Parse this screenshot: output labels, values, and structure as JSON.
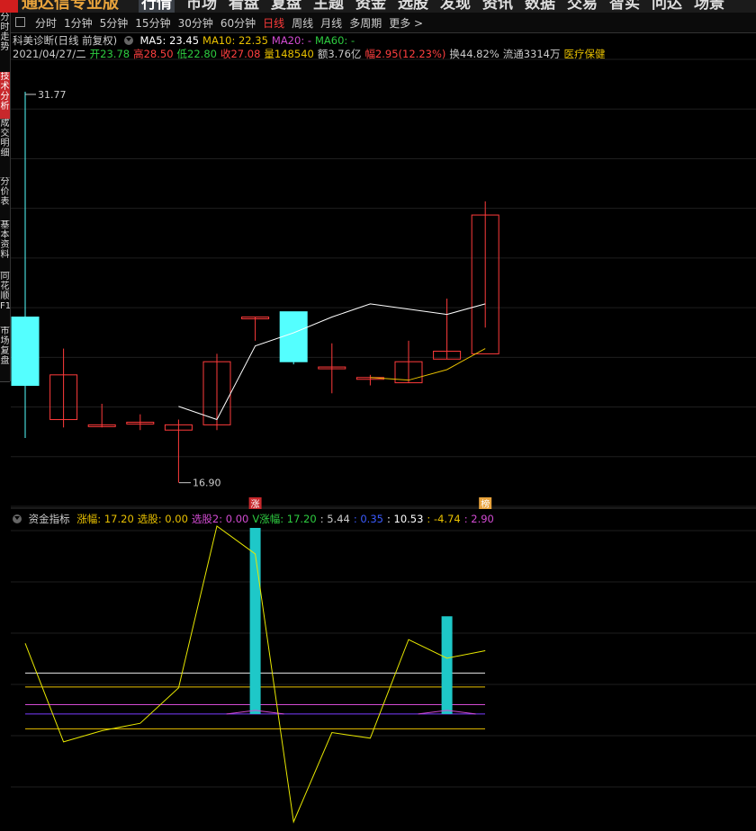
{
  "top_menu": {
    "app_name": "通达信专业版",
    "items": [
      "行情",
      "市场",
      "看盘",
      "复盘",
      "主题",
      "资金",
      "选股",
      "发现",
      "资讯",
      "数据",
      "交易",
      "智实",
      "问达",
      "场景"
    ],
    "active_index": 0
  },
  "sidebar": {
    "tabs": [
      {
        "label": "分时走势",
        "active": false
      },
      {
        "label": "技术分析",
        "active": true
      },
      {
        "label": "成交明细",
        "active": false
      },
      {
        "label": "分价表",
        "active": false
      },
      {
        "label": "基本资料",
        "active": false
      },
      {
        "label": "同花顺F10",
        "active": false
      },
      {
        "label": "市场复盘",
        "active": false
      }
    ]
  },
  "period_bar": {
    "items": [
      "分时",
      "1分钟",
      "5分钟",
      "15分钟",
      "30分钟",
      "60分钟",
      "日线",
      "周线",
      "月线",
      "多周期",
      "更多 >"
    ],
    "active": "日线"
  },
  "main_chart": {
    "title": "科美诊断(日线 前复权)",
    "ma": [
      {
        "label": "MA5: 23.45",
        "color": "#ffffff"
      },
      {
        "label": "MA10: 22.35",
        "color": "#e8c000"
      },
      {
        "label": "MA20: -",
        "color": "#d24bd2"
      },
      {
        "label": "MA60: -",
        "color": "#2ecc40"
      }
    ],
    "quote": [
      {
        "text": "2021/04/27/二",
        "color": "#cccccc"
      },
      {
        "text": "开23.78",
        "color": "#2ecc40"
      },
      {
        "text": "高28.50",
        "color": "#ff4040"
      },
      {
        "text": "低22.80",
        "color": "#2ecc40"
      },
      {
        "text": "收27.08",
        "color": "#ff4040"
      },
      {
        "text": "量148540",
        "color": "#e8c000"
      },
      {
        "text": "额3.76亿",
        "color": "#cccccc"
      },
      {
        "text": "幅2.95(12.23%)",
        "color": "#ff4040"
      },
      {
        "text": "换44.82%",
        "color": "#cccccc"
      },
      {
        "text": "流通3314万",
        "color": "#cccccc"
      },
      {
        "text": "医疗保健",
        "color": "#e8c000"
      }
    ],
    "high_label": "31.77",
    "low_label": "16.90",
    "badges": [
      {
        "text": "涨",
        "index": 6,
        "color": "#c8282c"
      },
      {
        "text": "榜",
        "index": 12,
        "color": "#e8a33c"
      }
    ]
  },
  "chart_data": {
    "type": "candlestick",
    "x": [
      1,
      2,
      3,
      4,
      5,
      6,
      7,
      8,
      9,
      10,
      11,
      12,
      13
    ],
    "ylim": [
      16,
      33
    ],
    "ohlc": [
      {
        "open": 23.2,
        "high": 31.77,
        "low": 18.6,
        "close": 20.6
      },
      {
        "open": 19.3,
        "high": 22.0,
        "low": 19.0,
        "close": 21.0
      },
      {
        "open": 19.1,
        "high": 19.9,
        "low": 19.0,
        "close": 19.1
      },
      {
        "open": 19.2,
        "high": 19.5,
        "low": 18.9,
        "close": 19.2
      },
      {
        "open": 18.9,
        "high": 19.3,
        "low": 16.9,
        "close": 19.1
      },
      {
        "open": 19.1,
        "high": 21.8,
        "low": 18.9,
        "close": 21.5
      },
      {
        "open": 23.2,
        "high": 23.2,
        "low": 22.3,
        "close": 23.2
      },
      {
        "open": 23.4,
        "high": 23.4,
        "low": 21.4,
        "close": 21.5
      },
      {
        "open": 21.3,
        "high": 22.2,
        "low": 20.3,
        "close": 21.3
      },
      {
        "open": 20.9,
        "high": 21.0,
        "low": 20.6,
        "close": 20.9
      },
      {
        "open": 20.7,
        "high": 22.3,
        "low": 20.7,
        "close": 21.5
      },
      {
        "open": 21.6,
        "high": 23.9,
        "low": 21.6,
        "close": 21.9
      },
      {
        "open": 21.8,
        "high": 27.6,
        "low": 22.8,
        "close": 27.08
      }
    ],
    "ma5": [
      null,
      null,
      null,
      null,
      19.8,
      19.3,
      22.1,
      22.6,
      23.2,
      23.7,
      23.5,
      23.3,
      23.7
    ],
    "ma10": [
      null,
      null,
      null,
      null,
      null,
      null,
      null,
      null,
      null,
      20.9,
      20.8,
      21.2,
      22.0
    ],
    "indicator": {
      "title": "资金指标",
      "legend": [
        {
          "text": "涨幅: 17.20",
          "color": "#e8c000"
        },
        {
          "text": "选股: 0.00",
          "color": "#e8c000"
        },
        {
          "text": "选股2: 0.00",
          "color": "#d24bd2"
        },
        {
          "text": "V涨幅: 17.20",
          "color": "#2ecc40"
        },
        {
          "text": ": 5.44",
          "color": "#cccccc"
        },
        {
          "text": ": 0.35",
          "color": "#3b5bff"
        },
        {
          "text": ": 10.53",
          "color": "#ffffff"
        },
        {
          "text": ": -4.74",
          "color": "#e8c000"
        },
        {
          "text": ": 2.90",
          "color": "#d24bd2"
        }
      ],
      "ylim": [
        -12,
        20
      ],
      "line": [
        7.6,
        -3.0,
        -1.8,
        -1.0,
        2.8,
        20.2,
        17.2,
        -11.6,
        -2.0,
        -2.6,
        8.0,
        6.0,
        6.8
      ],
      "bars": [
        {
          "index": 6,
          "value": 20.0
        },
        {
          "index": 11,
          "value": 10.5
        }
      ],
      "hlines": [
        {
          "value": 4.4,
          "color": "#e8e8e8"
        },
        {
          "value": 2.9,
          "color": "#e8c000"
        },
        {
          "value": 1.0,
          "color": "#d24bd2"
        },
        {
          "value": 0.0,
          "color": "#7a3cff"
        },
        {
          "value": -1.6,
          "color": "#e8c000"
        }
      ]
    }
  }
}
